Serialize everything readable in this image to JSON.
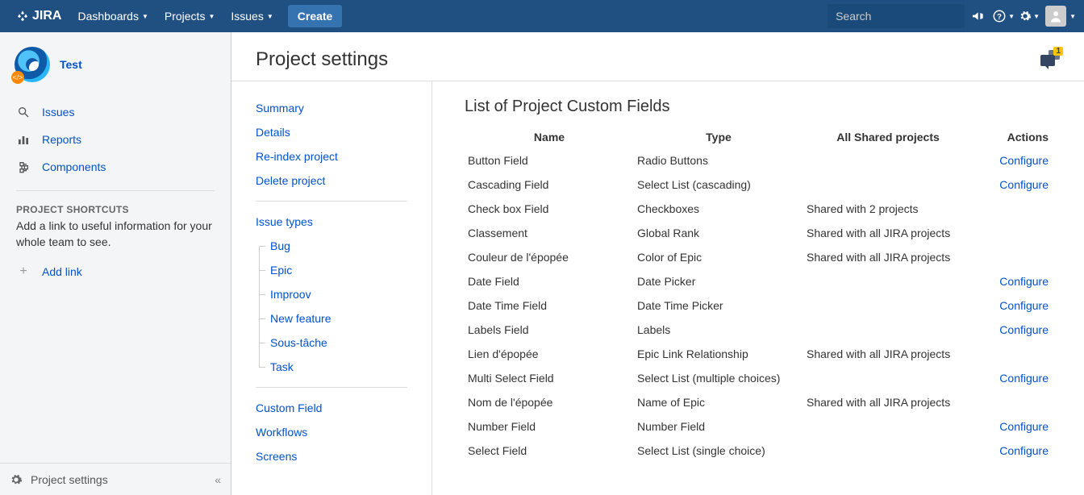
{
  "nav": {
    "logo": "JIRA",
    "items": [
      "Dashboards",
      "Projects",
      "Issues"
    ],
    "create": "Create",
    "search_placeholder": "Search"
  },
  "sidebar": {
    "project_name": "Test",
    "links": [
      {
        "label": "Issues"
      },
      {
        "label": "Reports"
      },
      {
        "label": "Components"
      }
    ],
    "shortcuts_head": "PROJECT SHORTCUTS",
    "shortcuts_text": "Add a link to useful information for your whole team to see.",
    "add_link": "Add link",
    "footer": "Project settings"
  },
  "main": {
    "title": "Project settings",
    "feedback_count": "1",
    "settings_nav": {
      "group1": [
        "Summary",
        "Details",
        "Re-index project",
        "Delete project"
      ],
      "issue_types_label": "Issue types",
      "issue_types": [
        "Bug",
        "Epic",
        "Improov",
        "New feature",
        "Sous-tâche",
        "Task"
      ],
      "group2": [
        "Custom Field",
        "Workflows",
        "Screens"
      ]
    },
    "content": {
      "heading": "List of Project Custom Fields",
      "columns": [
        "Name",
        "Type",
        "All Shared projects",
        "Actions"
      ],
      "configure_label": "Configure",
      "rows": [
        {
          "name": "Button Field",
          "type": "Radio Buttons",
          "shared": "",
          "configure": true
        },
        {
          "name": "Cascading Field",
          "type": "Select List (cascading)",
          "shared": "",
          "configure": true
        },
        {
          "name": "Check box Field",
          "type": "Checkboxes",
          "shared": "Shared with 2 projects",
          "configure": false
        },
        {
          "name": "Classement",
          "type": "Global Rank",
          "shared": "Shared with all JIRA projects",
          "configure": false
        },
        {
          "name": "Couleur de l'épopée",
          "type": "Color of Epic",
          "shared": "Shared with all JIRA projects",
          "configure": false
        },
        {
          "name": "Date Field",
          "type": "Date Picker",
          "shared": "",
          "configure": true
        },
        {
          "name": "Date Time Field",
          "type": "Date Time Picker",
          "shared": "",
          "configure": true
        },
        {
          "name": "Labels Field",
          "type": "Labels",
          "shared": "",
          "configure": true
        },
        {
          "name": "Lien d'épopée",
          "type": "Epic Link Relationship",
          "shared": "Shared with all JIRA projects",
          "configure": false
        },
        {
          "name": "Multi Select Field",
          "type": "Select List (multiple choices)",
          "shared": "",
          "configure": true
        },
        {
          "name": "Nom de l'épopée",
          "type": "Name of Epic",
          "shared": "Shared with all JIRA projects",
          "configure": false
        },
        {
          "name": "Number Field",
          "type": "Number Field",
          "shared": "",
          "configure": true
        },
        {
          "name": "Select Field",
          "type": "Select List (single choice)",
          "shared": "",
          "configure": true
        }
      ]
    }
  }
}
